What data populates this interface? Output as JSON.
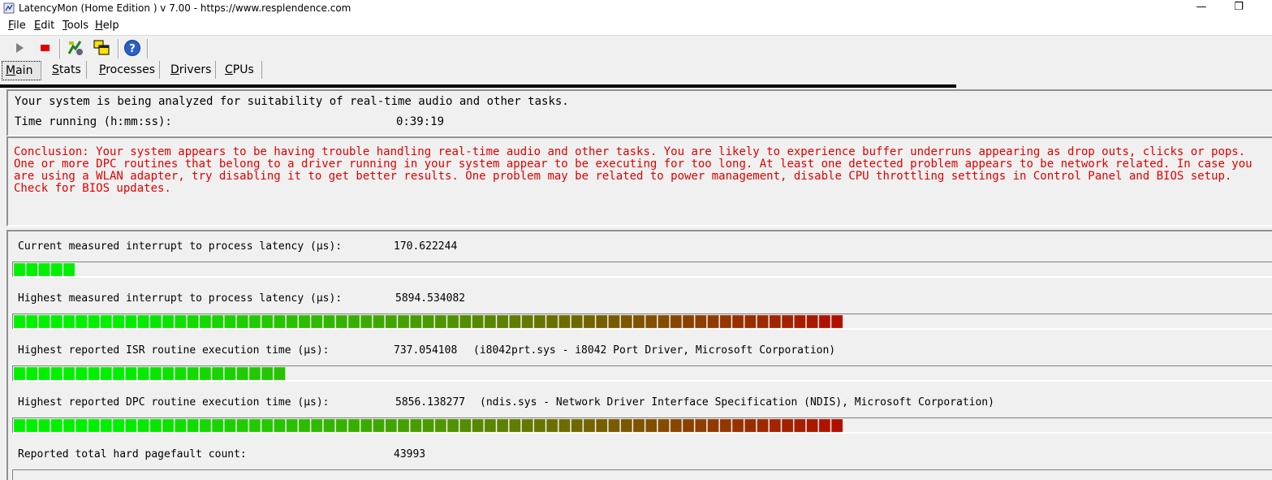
{
  "window": {
    "title": "LatencyMon  (Home Edition )  v 7.00 - https://www.resplendence.com",
    "minimize_glyph": "—",
    "restore_glyph": "❐"
  },
  "menu": {
    "items": [
      {
        "underline": "F",
        "rest": "ile"
      },
      {
        "underline": "E",
        "rest": "dit"
      },
      {
        "underline": "T",
        "rest": "ools"
      },
      {
        "underline": "H",
        "rest": "elp"
      }
    ]
  },
  "toolbar": {
    "icons": [
      "play-icon",
      "stop-icon",
      "driver-icon",
      "windows-icon",
      "help-icon"
    ],
    "colors": {
      "stop": "#e00000",
      "play": "#808080",
      "help": "#2a5fc8"
    }
  },
  "tabs": [
    {
      "underline": "M",
      "rest": "ain",
      "active": true
    },
    {
      "underline": "S",
      "rest": "tats",
      "active": false
    },
    {
      "underline": "P",
      "rest": "rocesses",
      "active": false
    },
    {
      "underline": "D",
      "rest": "rivers",
      "active": false
    },
    {
      "underline": "C",
      "rest": "PUs",
      "active": false
    }
  ],
  "status": {
    "analyzing": "Your system is being analyzed for suitability of real-time audio and other tasks.",
    "time_label": "Time running (h:mm:ss):",
    "time_value": "0:39:19"
  },
  "conclusion": {
    "text": "Conclusion: Your system appears to be having trouble handling real-time audio and other tasks. You are likely to experience buffer underruns appearing as drop outs, clicks or pops. One or more DPC routines that belong to a driver running in your system appear to be executing for too long. At least one detected problem appears to be network related. In case you are using a WLAN adapter, try disabling it to get better results. One problem may be related to power management, disable CPU throttling settings in Control Panel and BIOS setup. Check for BIOS updates.",
    "color": "#e00000"
  },
  "metrics": {
    "current": {
      "label": "Current measured interrupt to process latency (µs):",
      "value": "170.622244",
      "extra": "",
      "segments": 5
    },
    "highest": {
      "label": "Highest measured interrupt to process latency (µs):",
      "value": "5894.534082",
      "extra": "",
      "segments": 67
    },
    "isr": {
      "label": "Highest reported ISR routine execution time (µs):",
      "value": "737.054108",
      "extra": "(i8042prt.sys - i8042 Port Driver, Microsoft Corporation)",
      "segments": 22
    },
    "dpc": {
      "label": "Highest reported DPC routine execution time (µs):",
      "value": "5856.138277",
      "extra": "(ndis.sys - Network Driver Interface Specification (NDIS), Microsoft Corporation)",
      "segments": 67
    },
    "pagefault": {
      "label": "Reported total hard pagefault count:",
      "value": "43993"
    }
  },
  "meter_colors": {
    "start": "#00f000",
    "mid": "#4a9a00",
    "end": "#b01000"
  }
}
